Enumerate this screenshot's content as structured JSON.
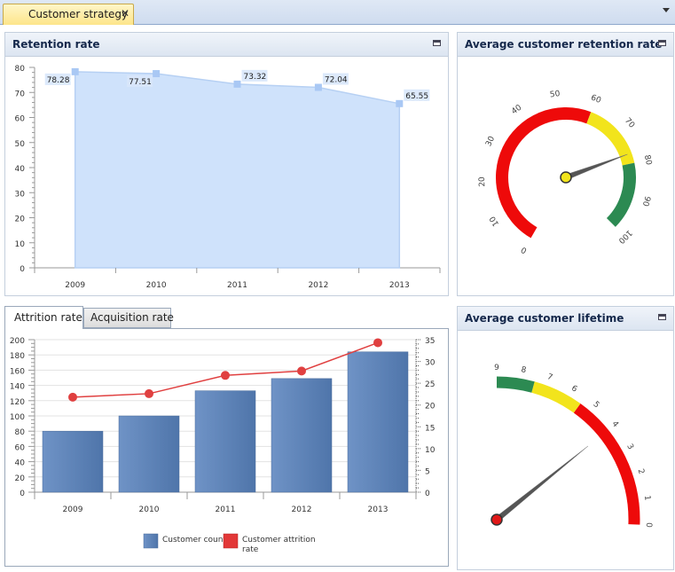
{
  "document_tab": {
    "label": "Customer strategy",
    "close": "✕"
  },
  "panels": {
    "retention": {
      "title": "Retention rate"
    },
    "avg_retention": {
      "title": "Average customer retention rate"
    },
    "lifetime": {
      "title": "Average customer lifetime"
    }
  },
  "lower_tabs": {
    "attrition": "Attrition rate",
    "acquisition": "Acquisition rate"
  },
  "chart_data": [
    {
      "type": "area",
      "categories": [
        "2009",
        "2010",
        "2011",
        "2012",
        "2013"
      ],
      "values": [
        78.28,
        77.51,
        73.32,
        72.04,
        65.55
      ],
      "data_labels": [
        "78.28",
        "77.51",
        "73.32",
        "72.04",
        "65.55"
      ],
      "ylim": [
        0,
        80
      ],
      "yticks": [
        "0",
        "10",
        "20",
        "30",
        "40",
        "50",
        "60",
        "70",
        "80"
      ],
      "color": "#cfe2fb"
    },
    {
      "type": "gauge",
      "min": 0,
      "max": 100,
      "value": 77,
      "tick_labels": [
        "0",
        "10",
        "20",
        "30",
        "40",
        "50",
        "60",
        "70",
        "80",
        "90",
        "100"
      ],
      "bands": [
        {
          "from": 0,
          "to": 60,
          "color": "#ee0a0a"
        },
        {
          "from": 60,
          "to": 80,
          "color": "#f2e41c"
        },
        {
          "from": 80,
          "to": 100,
          "color": "#2c8a52"
        }
      ],
      "needle_cap_color": "#f2e41c"
    },
    {
      "type": "bar",
      "categories": [
        "2009",
        "2010",
        "2011",
        "2012",
        "2013"
      ],
      "series": [
        {
          "name": "Customer count",
          "type": "bar",
          "axis": "left",
          "values": [
            80,
            100,
            133,
            149,
            184
          ],
          "color": "#5b83b8"
        },
        {
          "name": "Customer attrition rate",
          "type": "line",
          "axis": "right",
          "values": [
            21.8,
            22.6,
            26.8,
            27.8,
            34.3
          ],
          "color": "#e04040"
        }
      ],
      "ylim": [
        0,
        200
      ],
      "yticks": [
        "0",
        "20",
        "40",
        "60",
        "80",
        "100",
        "120",
        "140",
        "160",
        "180",
        "200"
      ],
      "y2lim": [
        0,
        35
      ],
      "y2ticks": [
        "0",
        "5",
        "10",
        "15",
        "20",
        "25",
        "30",
        "35"
      ],
      "legend": [
        "Customer count",
        "Customer attrition rate"
      ]
    },
    {
      "type": "gauge",
      "min": 0,
      "max": 9,
      "value": 4,
      "tick_labels": [
        "0",
        "1",
        "2",
        "3",
        "4",
        "5",
        "6",
        "7",
        "8",
        "9"
      ],
      "bands": [
        {
          "from": 0,
          "to": 5.5,
          "color": "#ee0a0a"
        },
        {
          "from": 5.5,
          "to": 7.5,
          "color": "#f2e41c"
        },
        {
          "from": 7.5,
          "to": 9,
          "color": "#2c8a52"
        }
      ],
      "needle_cap_color": "#e01818"
    }
  ]
}
